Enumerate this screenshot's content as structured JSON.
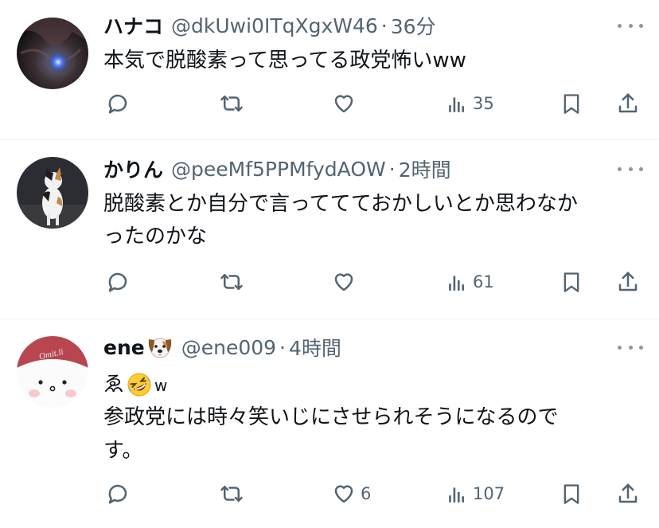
{
  "tweets": [
    {
      "name": "ハナコ",
      "handle": "@dkUwi0ITqXgxW46",
      "sep": "·",
      "time": "36分",
      "lines": [
        "本気で脱酸素って思ってる政党怖いww"
      ],
      "views": "35",
      "likes": ""
    },
    {
      "name": "かりん",
      "handle": "@peeMf5PPMfydAOW",
      "sep": "·",
      "time": "2時間",
      "lines": [
        "脱酸素とか自分で言っててておかしいとか思わなか",
        "ったのかな"
      ],
      "views": "61",
      "likes": ""
    },
    {
      "name": "ene",
      "name_emoji": "dog-face-emoji",
      "handle": "@ene009",
      "sep": "·",
      "time": "4時間",
      "line_prefix": "ゑ",
      "line_suffix": "w",
      "line_emoji": "rolling-on-floor-laughing-emoji",
      "lines": [
        "参政党には時々笑いじにさせられそうになるので",
        "す。"
      ],
      "views": "107",
      "likes": "6"
    }
  ],
  "avatar3_text": "Omit.li",
  "colors": {
    "text": "#0f1419",
    "secondary": "#536471",
    "separator": "#eff3f4"
  }
}
